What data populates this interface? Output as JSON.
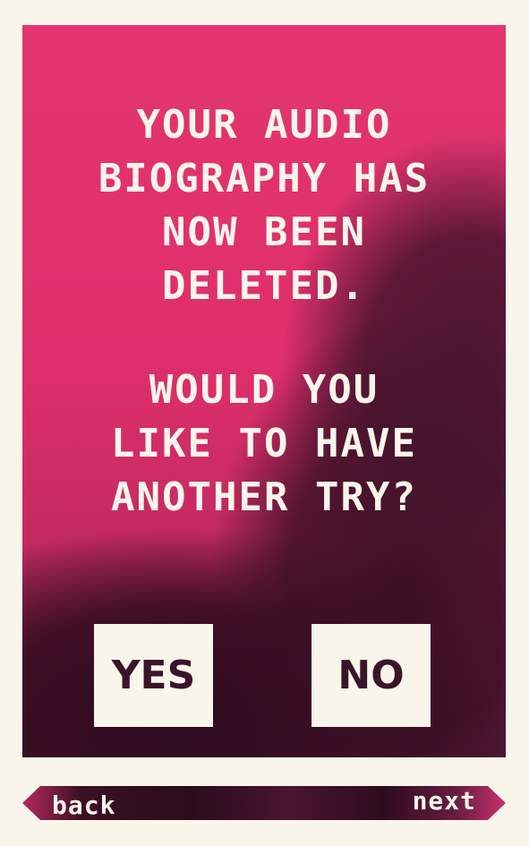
{
  "dialog": {
    "message_line1": "YOUR AUDIO\nBIOGRAPHY HAS\nNOW BEEN\nDELETED.",
    "message_line2": "WOULD YOU\nLIKE TO HAVE\nANOTHER TRY?",
    "yes_label": "YES",
    "no_label": "NO"
  },
  "nav": {
    "back_label": "back",
    "next_label": "next"
  },
  "colors": {
    "background": "#f9f5ea",
    "card_pink": "#e3356f",
    "ink_dark": "#3a1428"
  }
}
